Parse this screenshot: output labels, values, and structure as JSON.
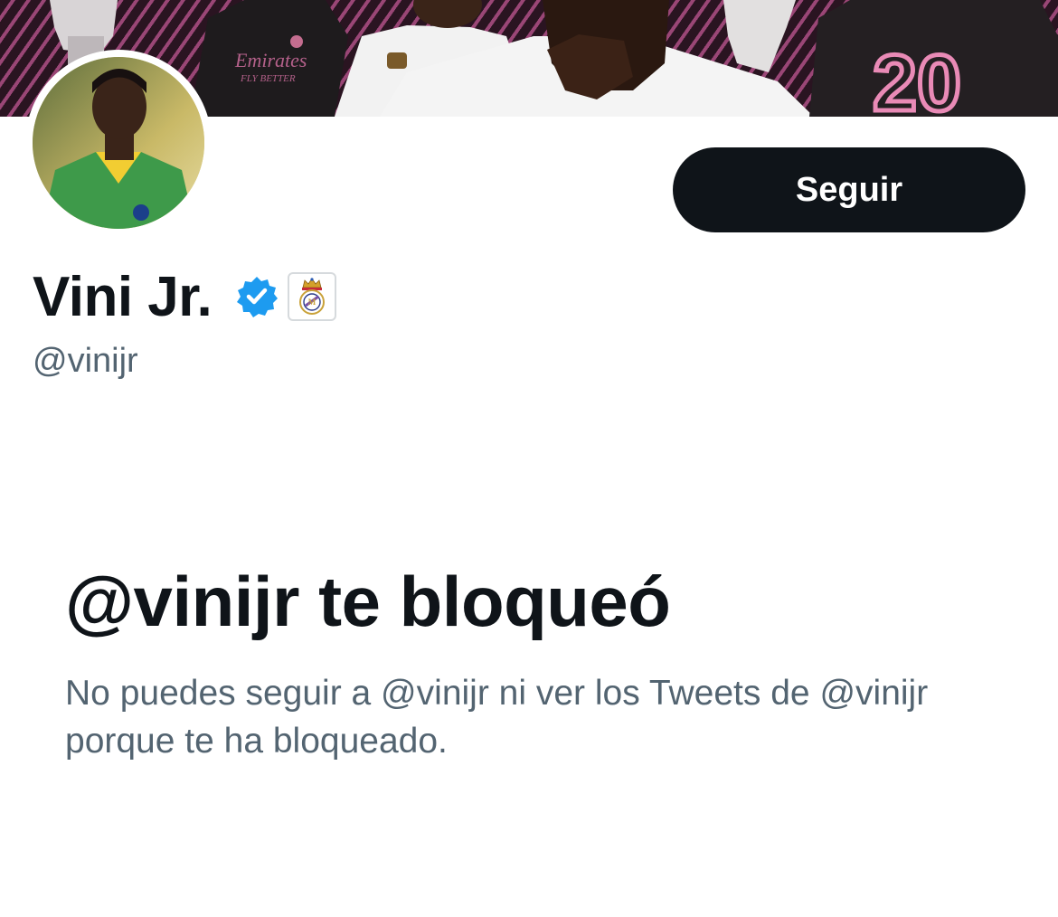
{
  "profile": {
    "display_name": "Vini Jr.",
    "handle": "@vinijr",
    "verified_icon": "verified-check-icon",
    "affiliate_badge_icon": "real-madrid-crest-icon",
    "banner_jersey_text": "Emirates",
    "banner_jersey_subtext": "FLY BETTER",
    "banner_jersey_number": "20"
  },
  "actions": {
    "follow_label": "Seguir"
  },
  "blocked": {
    "title": "@vinijr te bloqueó",
    "description": "No puedes seguir a @vinijr ni ver los Tweets de @vinijr porque te ha bloqueado."
  },
  "colors": {
    "text_primary": "#0f1419",
    "text_secondary": "#536471",
    "verified_blue": "#1d9bf0",
    "banner_pink": "#e98ab6"
  }
}
